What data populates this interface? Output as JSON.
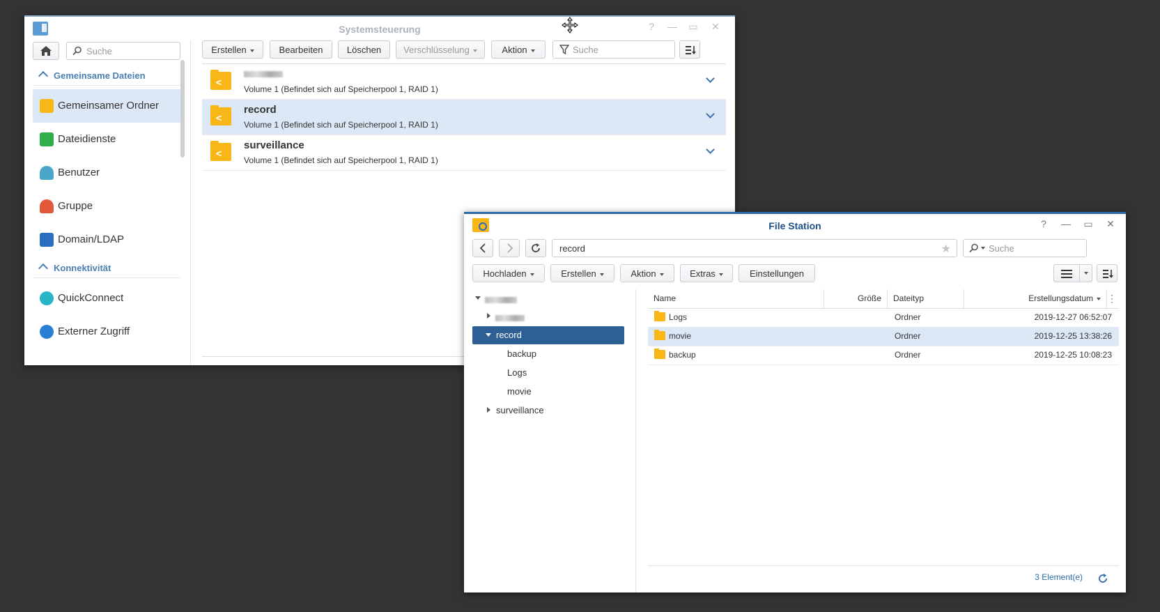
{
  "systemsteuerung": {
    "title": "Systemsteuerung",
    "window_controls": {
      "help": "?",
      "minimize": "—",
      "maximize": "▭",
      "close": "✕"
    },
    "sidebar": {
      "search_placeholder": "Suche",
      "sections": [
        {
          "label": "Gemeinsame Dateien"
        },
        {
          "label": "Konnektivität"
        }
      ],
      "items": [
        {
          "label": "Gemeinsamer Ordner",
          "icon": "shared-folder-icon",
          "selected": true
        },
        {
          "label": "Dateidienste",
          "icon": "file-services-icon"
        },
        {
          "label": "Benutzer",
          "icon": "user-icon"
        },
        {
          "label": "Gruppe",
          "icon": "group-icon"
        },
        {
          "label": "Domain/LDAP",
          "icon": "domain-ldap-icon"
        },
        {
          "label": "QuickConnect",
          "icon": "quickconnect-icon"
        },
        {
          "label": "Externer Zugriff",
          "icon": "external-access-icon"
        }
      ]
    },
    "toolbar": {
      "create": "Erstellen",
      "edit": "Bearbeiten",
      "delete": "Löschen",
      "encryption": "Verschlüsselung",
      "action": "Aktion",
      "search_placeholder": "Suche"
    },
    "shares": [
      {
        "name": "",
        "desc": "Volume 1 (Befindet sich auf Speicherpool 1, RAID 1)",
        "blurred": true
      },
      {
        "name": "record",
        "desc": "Volume 1 (Befindet sich auf Speicherpool 1, RAID 1)",
        "selected": true
      },
      {
        "name": "surveillance",
        "desc": "Volume 1 (Befindet sich auf Speicherpool 1, RAID 1)"
      }
    ]
  },
  "filestation": {
    "title": "File Station",
    "window_controls": {
      "help": "?",
      "minimize": "—",
      "maximize": "▭",
      "close": "✕"
    },
    "path": "record",
    "search_placeholder": "Suche",
    "toolbar": {
      "upload": "Hochladen",
      "create": "Erstellen",
      "action": "Aktion",
      "extras": "Extras",
      "settings": "Einstellungen"
    },
    "tree": [
      {
        "label": "",
        "blurred": true
      },
      {
        "label": "",
        "blurred": true
      },
      {
        "label": "record",
        "selected": true
      },
      {
        "label": "backup"
      },
      {
        "label": "Logs"
      },
      {
        "label": "movie"
      },
      {
        "label": "surveillance"
      }
    ],
    "columns": {
      "name": "Name",
      "size": "Größe",
      "type": "Dateityp",
      "created": "Erstellungsdatum"
    },
    "files": [
      {
        "name": "Logs",
        "size": "",
        "type": "Ordner",
        "created": "2019-12-27 06:52:07"
      },
      {
        "name": "movie",
        "size": "",
        "type": "Ordner",
        "created": "2019-12-25 13:38:26",
        "selected": true
      },
      {
        "name": "backup",
        "size": "",
        "type": "Ordner",
        "created": "2019-12-25 10:08:23"
      }
    ],
    "status": "3 Element(e)"
  }
}
